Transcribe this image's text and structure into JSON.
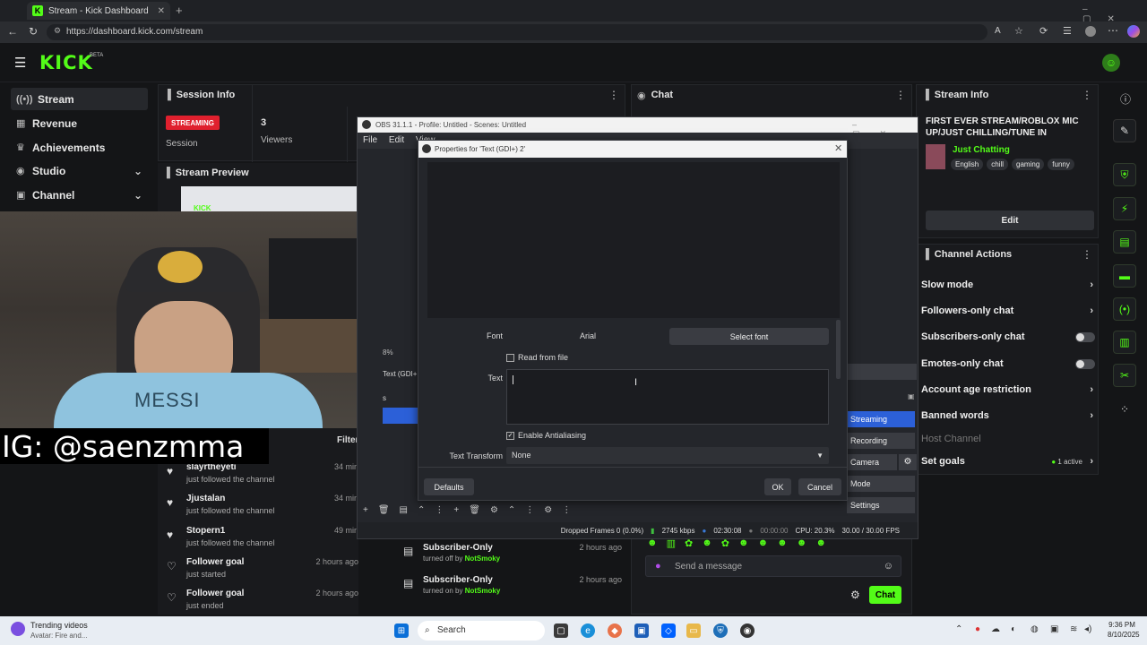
{
  "browser": {
    "tab_title": "Stream - Kick Dashboard",
    "url": "https://dashboard.kick.com/stream"
  },
  "kick": {
    "logo": "KICK",
    "beta": "BETA",
    "accent": "#53fc18"
  },
  "sidebar": {
    "items": [
      {
        "label": "Stream",
        "icon": "broadcast-icon"
      },
      {
        "label": "Revenue",
        "icon": "revenue-icon"
      },
      {
        "label": "Achievements",
        "icon": "trophy-icon"
      },
      {
        "label": "Studio",
        "icon": "studio-icon"
      },
      {
        "label": "Channel",
        "icon": "channel-icon"
      }
    ]
  },
  "session": {
    "title": "Session Info",
    "badge": "STREAMING",
    "session_label": "Session",
    "viewers_count": "3",
    "viewers_label": "Viewers"
  },
  "preview": {
    "title": "Stream Preview"
  },
  "chat": {
    "title": "Chat",
    "placeholder": "Send a message",
    "chat_button": "Chat"
  },
  "activity": {
    "filter": "Filter",
    "items": [
      {
        "who": "slayrtheyeti",
        "what": "just followed the channel",
        "when": "34 min"
      },
      {
        "who": "Jjustalan",
        "what": "just followed the channel",
        "when": "34 min"
      },
      {
        "who": "Stopern1",
        "what": "just followed the channel",
        "when": "49 min"
      },
      {
        "who": "Follower goal",
        "what": "just started",
        "when": "2 hours ago"
      },
      {
        "who": "Follower goal",
        "what": "just ended",
        "when": "2 hours ago"
      }
    ]
  },
  "subs": [
    {
      "title": "Subscriber-Only",
      "pre": "turned off by",
      "user": "NotSmoky",
      "when": "2 hours ago"
    },
    {
      "title": "Subscriber-Only",
      "pre": "turned on by",
      "user": "NotSmoky",
      "when": "2 hours ago"
    }
  ],
  "stream_info": {
    "title": "Stream Info",
    "stream_title": "FIRST EVER STREAM/ROBLOX MIC UP/JUST CHILLING/TUNE IN",
    "category": "Just Chatting",
    "tags": [
      "English",
      "chill",
      "gaming",
      "funny"
    ],
    "edit": "Edit"
  },
  "channel_actions": {
    "title": "Channel Actions",
    "items": [
      {
        "label": "Slow mode",
        "control": "chevron"
      },
      {
        "label": "Followers-only chat",
        "control": "chevron"
      },
      {
        "label": "Subscribers-only chat",
        "control": "toggle"
      },
      {
        "label": "Emotes-only chat",
        "control": "toggle"
      },
      {
        "label": "Account age restriction",
        "control": "chevron"
      },
      {
        "label": "Banned words",
        "control": "chevron"
      },
      {
        "label": "Host Channel",
        "control": "none"
      },
      {
        "label": "Set goals",
        "control": "active"
      }
    ],
    "active_label": "1 active"
  },
  "webcam": {
    "overlay_text": "IG: @saenzmma",
    "shirt_text": "MESSI"
  },
  "obs": {
    "title": "OBS 31.1.1 - Profile: Untitled - Scenes: Untitled",
    "menu": [
      "File",
      "Edit",
      "View"
    ],
    "controls": [
      "Streaming",
      "Recording",
      "Camera",
      "Mode",
      "Settings"
    ],
    "status": {
      "dropped": "Dropped Frames 0 (0.0%)",
      "kbps": "2745 kbps",
      "time1": "02:30:08",
      "time2": "00:00:00",
      "cpu": "CPU: 20.3%",
      "fps": "30.00 / 30.00 FPS"
    },
    "side_labels": [
      "8%",
      "Text (GDI+",
      "s"
    ]
  },
  "dialog": {
    "title": "Properties for 'Text (GDI+) 2'",
    "font_label": "Font",
    "font_value": "Arial",
    "select_font": "Select font",
    "read_from_file": "Read from file",
    "text_label": "Text",
    "antialias": "Enable Antialiasing",
    "transform_label": "Text Transform",
    "transform_value": "None",
    "defaults": "Defaults",
    "ok": "OK",
    "cancel": "Cancel"
  },
  "taskbar": {
    "trending_title": "Trending videos",
    "trending_sub": "Avatar: Fire and...",
    "search": "Search",
    "time": "9:36 PM",
    "date": "8/10/2025"
  }
}
